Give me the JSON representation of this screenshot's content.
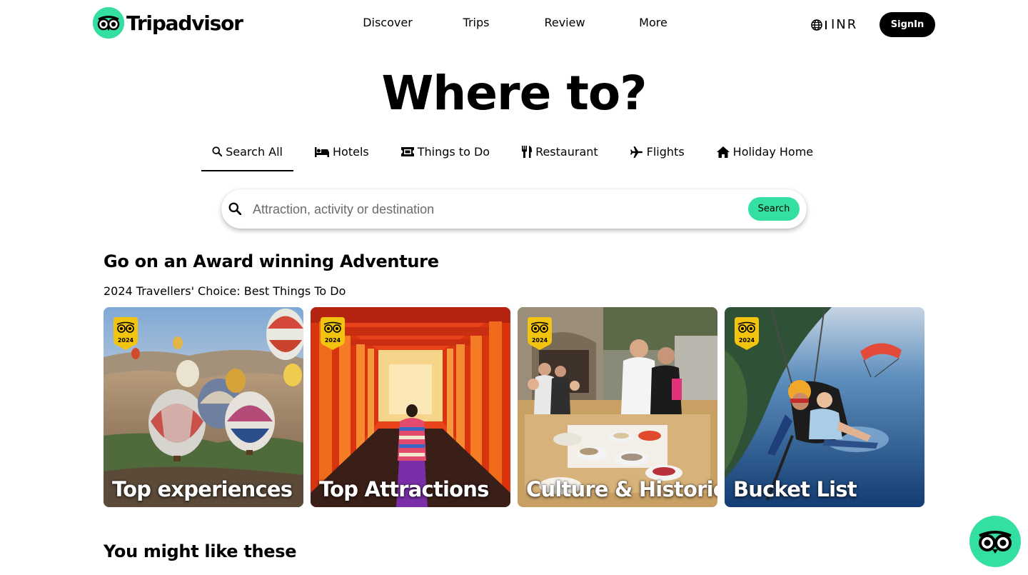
{
  "header": {
    "logo_text": "Tripadvisor",
    "nav": [
      "Discover",
      "Trips",
      "Review",
      "More"
    ],
    "currency": "INR",
    "signin_label": "SignIn"
  },
  "hero": {
    "title": "Where to?"
  },
  "tabs": [
    {
      "label": "Search All",
      "icon": "search-icon",
      "active": true
    },
    {
      "label": "Hotels",
      "icon": "bed-icon",
      "active": false
    },
    {
      "label": "Things to Do",
      "icon": "ticket-icon",
      "active": false
    },
    {
      "label": "Restaurant",
      "icon": "utensils-icon",
      "active": false
    },
    {
      "label": "Flights",
      "icon": "plane-icon",
      "active": false
    },
    {
      "label": "Holiday Home",
      "icon": "home-icon",
      "active": false
    }
  ],
  "search": {
    "placeholder": "Attraction, activity or destination",
    "value": "",
    "button_label": "Search"
  },
  "awards": {
    "title": "Go on an Award winning Adventure",
    "subtitle": "2024 Travellers' Choice: Best Things To Do",
    "badge_year": "2024",
    "cards": [
      {
        "label": "Top experiences",
        "image": "hot-air-balloons"
      },
      {
        "label": "Top Attractions",
        "image": "torii-gates"
      },
      {
        "label": "Culture & Historic",
        "image": "cooking-class"
      },
      {
        "label": "Bucket List",
        "image": "paragliding"
      }
    ]
  },
  "recommendations": {
    "title": "You might like these"
  },
  "colors": {
    "brand": "#34e0a1",
    "text": "#000000",
    "badge": "#f2c40f"
  }
}
